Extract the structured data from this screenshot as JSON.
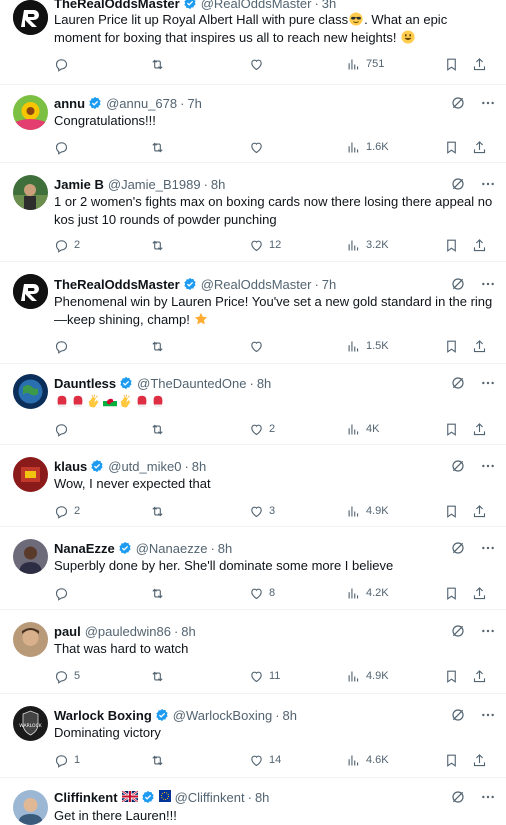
{
  "tweets": [
    {
      "name": "TheRealOddsMaster",
      "handle": "@RealOddsMaster",
      "time": "3h",
      "text_main": "Lauren Price lit up Royal Albert Hall with pure class",
      "text_after_emoji": ". What an epic moment for boxing that inspires us all to reach new heights!",
      "emoji": [
        "sunglasses-face-emoji",
        "grinning-face-emoji"
      ],
      "replies": "",
      "reposts": "",
      "likes": "",
      "views": "751",
      "avatar": "dark-logo-avatar"
    },
    {
      "name": "annu",
      "handle": "@annu_678",
      "time": "7h",
      "text": "Congratulations!!!",
      "replies": "",
      "reposts": "",
      "likes": "",
      "views": "1.6K",
      "avatar": "sunflower-avatar"
    },
    {
      "name": "Jamie B",
      "handle": "@Jamie_B1989",
      "time": "8h",
      "text_line1": "1 or 2 women's fights max on boxing cards now there losing there appeal no",
      "text_line2": "kos just 10 rounds of powder punching",
      "replies": "2",
      "reposts": "",
      "likes": "12",
      "views": "3.2K",
      "avatar": "photo-avatar"
    },
    {
      "name": "TheRealOddsMaster",
      "handle": "@RealOddsMaster",
      "time": "7h",
      "text_line1": "Phenomenal win by Lauren Price! You've set a new gold standard in the ring",
      "text_line2": "—keep shining, champ!",
      "emoji": [
        "star-emoji"
      ],
      "replies": "",
      "reposts": "",
      "likes": "",
      "views": "1.5K",
      "avatar": "dark-logo-avatar"
    },
    {
      "name": "Dauntless",
      "handle": "@TheDauntedOne",
      "time": "8h",
      "emoji": [
        "boxing-glove-emoji",
        "boxing-glove-emoji",
        "clapping-hands-emoji",
        "wales-flag-emoji",
        "clapping-hands-emoji",
        "boxing-glove-emoji",
        "boxing-glove-emoji"
      ],
      "replies": "",
      "reposts": "",
      "likes": "2",
      "views": "4K",
      "avatar": "globe-avatar"
    },
    {
      "name": "klaus",
      "handle": "@utd_mike0",
      "time": "8h",
      "text": "Wow, I never expected that",
      "replies": "2",
      "reposts": "",
      "likes": "3",
      "views": "4.9K",
      "avatar": "red-avatar"
    },
    {
      "name": "NanaEzze",
      "handle": "@Nanaezze",
      "time": "8h",
      "text": "Superbly done by her. She'll dominate some more I believe",
      "replies": "",
      "reposts": "",
      "likes": "8",
      "views": "4.2K",
      "avatar": "portrait-avatar"
    },
    {
      "name": "paul",
      "handle": "@pauledwin86",
      "time": "8h",
      "text": "That was hard to watch",
      "replies": "5",
      "reposts": "",
      "likes": "11",
      "views": "4.9K",
      "avatar": "face-avatar"
    },
    {
      "name": "Warlock Boxing",
      "handle": "@WarlockBoxing",
      "time": "8h",
      "text": "Dominating victory",
      "replies": "1",
      "reposts": "",
      "likes": "14",
      "views": "4.6K",
      "avatar": "warlock-logo-avatar",
      "avatar_text": "WARLOCK"
    },
    {
      "name": "Cliffinkent",
      "handle": "@Cliffinkent",
      "time": "8h",
      "text": "Get in there Lauren!!!",
      "emoji": [
        "uk-flag-emoji",
        "eu-flag-emoji"
      ],
      "avatar": "man-avatar"
    }
  ],
  "colors": {
    "verified": "#1d9bf0",
    "muted": "#536471",
    "text": "#0f1419",
    "divider": "#eff3f4"
  },
  "icons": [
    "reply-icon",
    "repost-icon",
    "like-icon",
    "views-icon",
    "bookmark-icon",
    "share-icon",
    "grok-icon",
    "more-icon",
    "verified-badge-icon"
  ]
}
